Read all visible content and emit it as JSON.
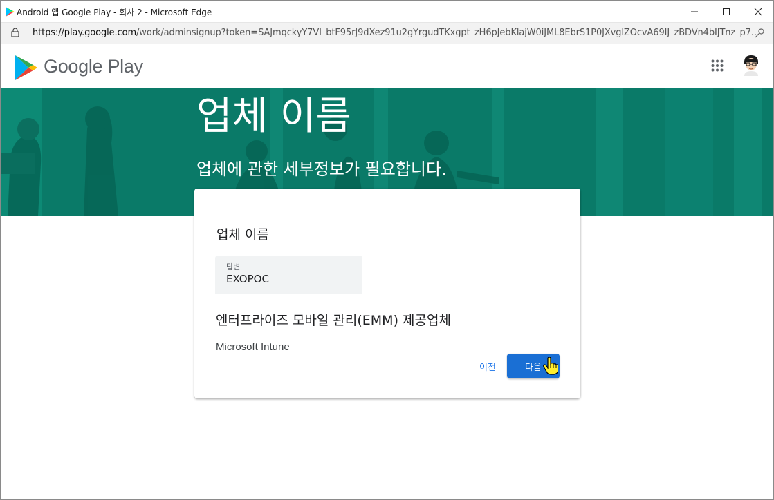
{
  "window": {
    "title": "Android 앱 Google Play - 회사 2 - Microsoft Edge",
    "controls": {
      "minimize": "—",
      "maximize": "☐",
      "close": "✕"
    }
  },
  "address_bar": {
    "url_host": "https://play.google.com",
    "url_rest": "/work/adminsignup?token=SAJmqckyY7VI_btF95rJ9dXez91u2gYrgudTKxgpt_zH6pJebKlajW0iJML8EbrS1P0JXvglZOcvA69IJ_zBDVn4bIJTnz_p7..."
  },
  "header": {
    "brand": "Google Play",
    "icons": [
      "google-play-logo-icon",
      "apps-grid-icon",
      "avatar"
    ]
  },
  "banner": {
    "title": "업체 이름",
    "subtitle": "업체에 관한 세부정보가 필요합니다.",
    "color": "#0a7a68"
  },
  "form": {
    "question1": "업체 이름",
    "field_label": "답변",
    "field_value": "EXOPOC",
    "question2": "엔터프라이즈 모바일 관리(EMM) 제공업체",
    "answer2": "Microsoft Intune",
    "prev_label": "이전",
    "next_label": "다음"
  },
  "colors": {
    "accent": "#1a73e8",
    "primary_button": "#1a6fd4"
  }
}
